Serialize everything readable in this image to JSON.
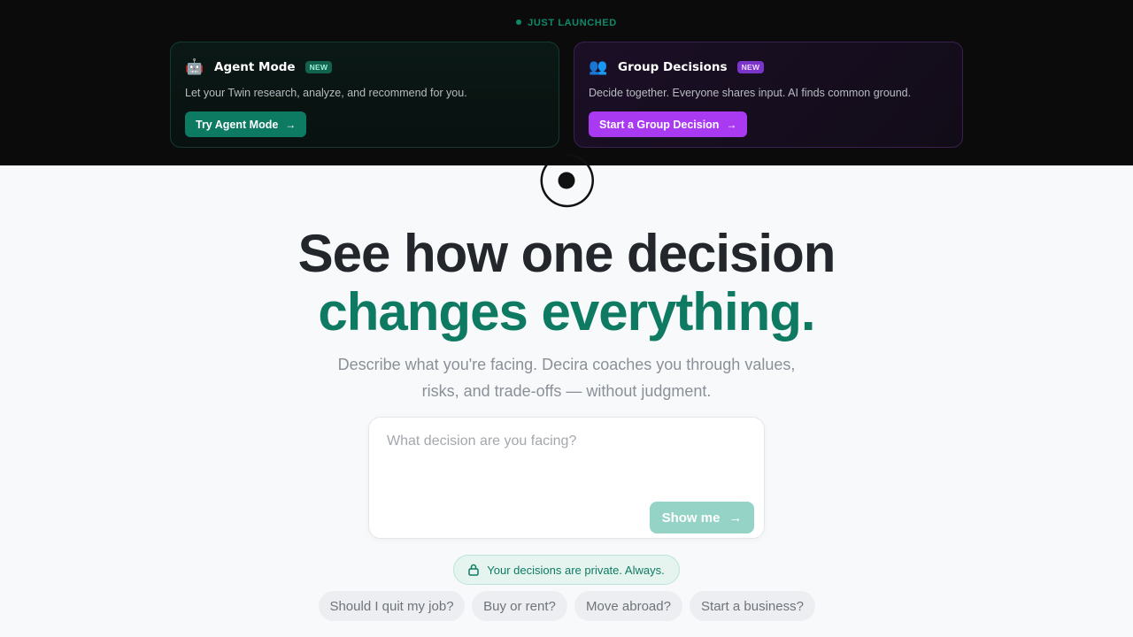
{
  "banner": {
    "label": "JUST LAUNCHED",
    "cards": [
      {
        "emoji": "🤖",
        "title": "Agent Mode",
        "badge": "NEW",
        "description": "Let your Twin research, analyze, and recommend for you.",
        "button": "Try Agent Mode",
        "accent": "#0d7a62"
      },
      {
        "emoji": "👥",
        "title": "Group Decisions",
        "badge": "NEW",
        "description": "Decide together. Everyone shares input. AI finds common ground.",
        "button": "Start a Group Decision",
        "accent": "#a93af2"
      }
    ]
  },
  "hero": {
    "line1": "See how one decision",
    "line2": "changes everything.",
    "subtitle": "Describe what you're facing. Decira coaches you through values, risks, and trade-offs — without judgment."
  },
  "composer": {
    "placeholder": "What decision are you facing?",
    "submit_label": "Show me"
  },
  "privacy_note": "Your decisions are private. Always.",
  "suggestions": [
    "Should I quit my job?",
    "Buy or rent?",
    "Move abroad?",
    "Start a business?"
  ],
  "colors": {
    "brand": "#0e7a62",
    "dark_band": "#0b0b0c",
    "page_bg": "#f7f9fb"
  }
}
